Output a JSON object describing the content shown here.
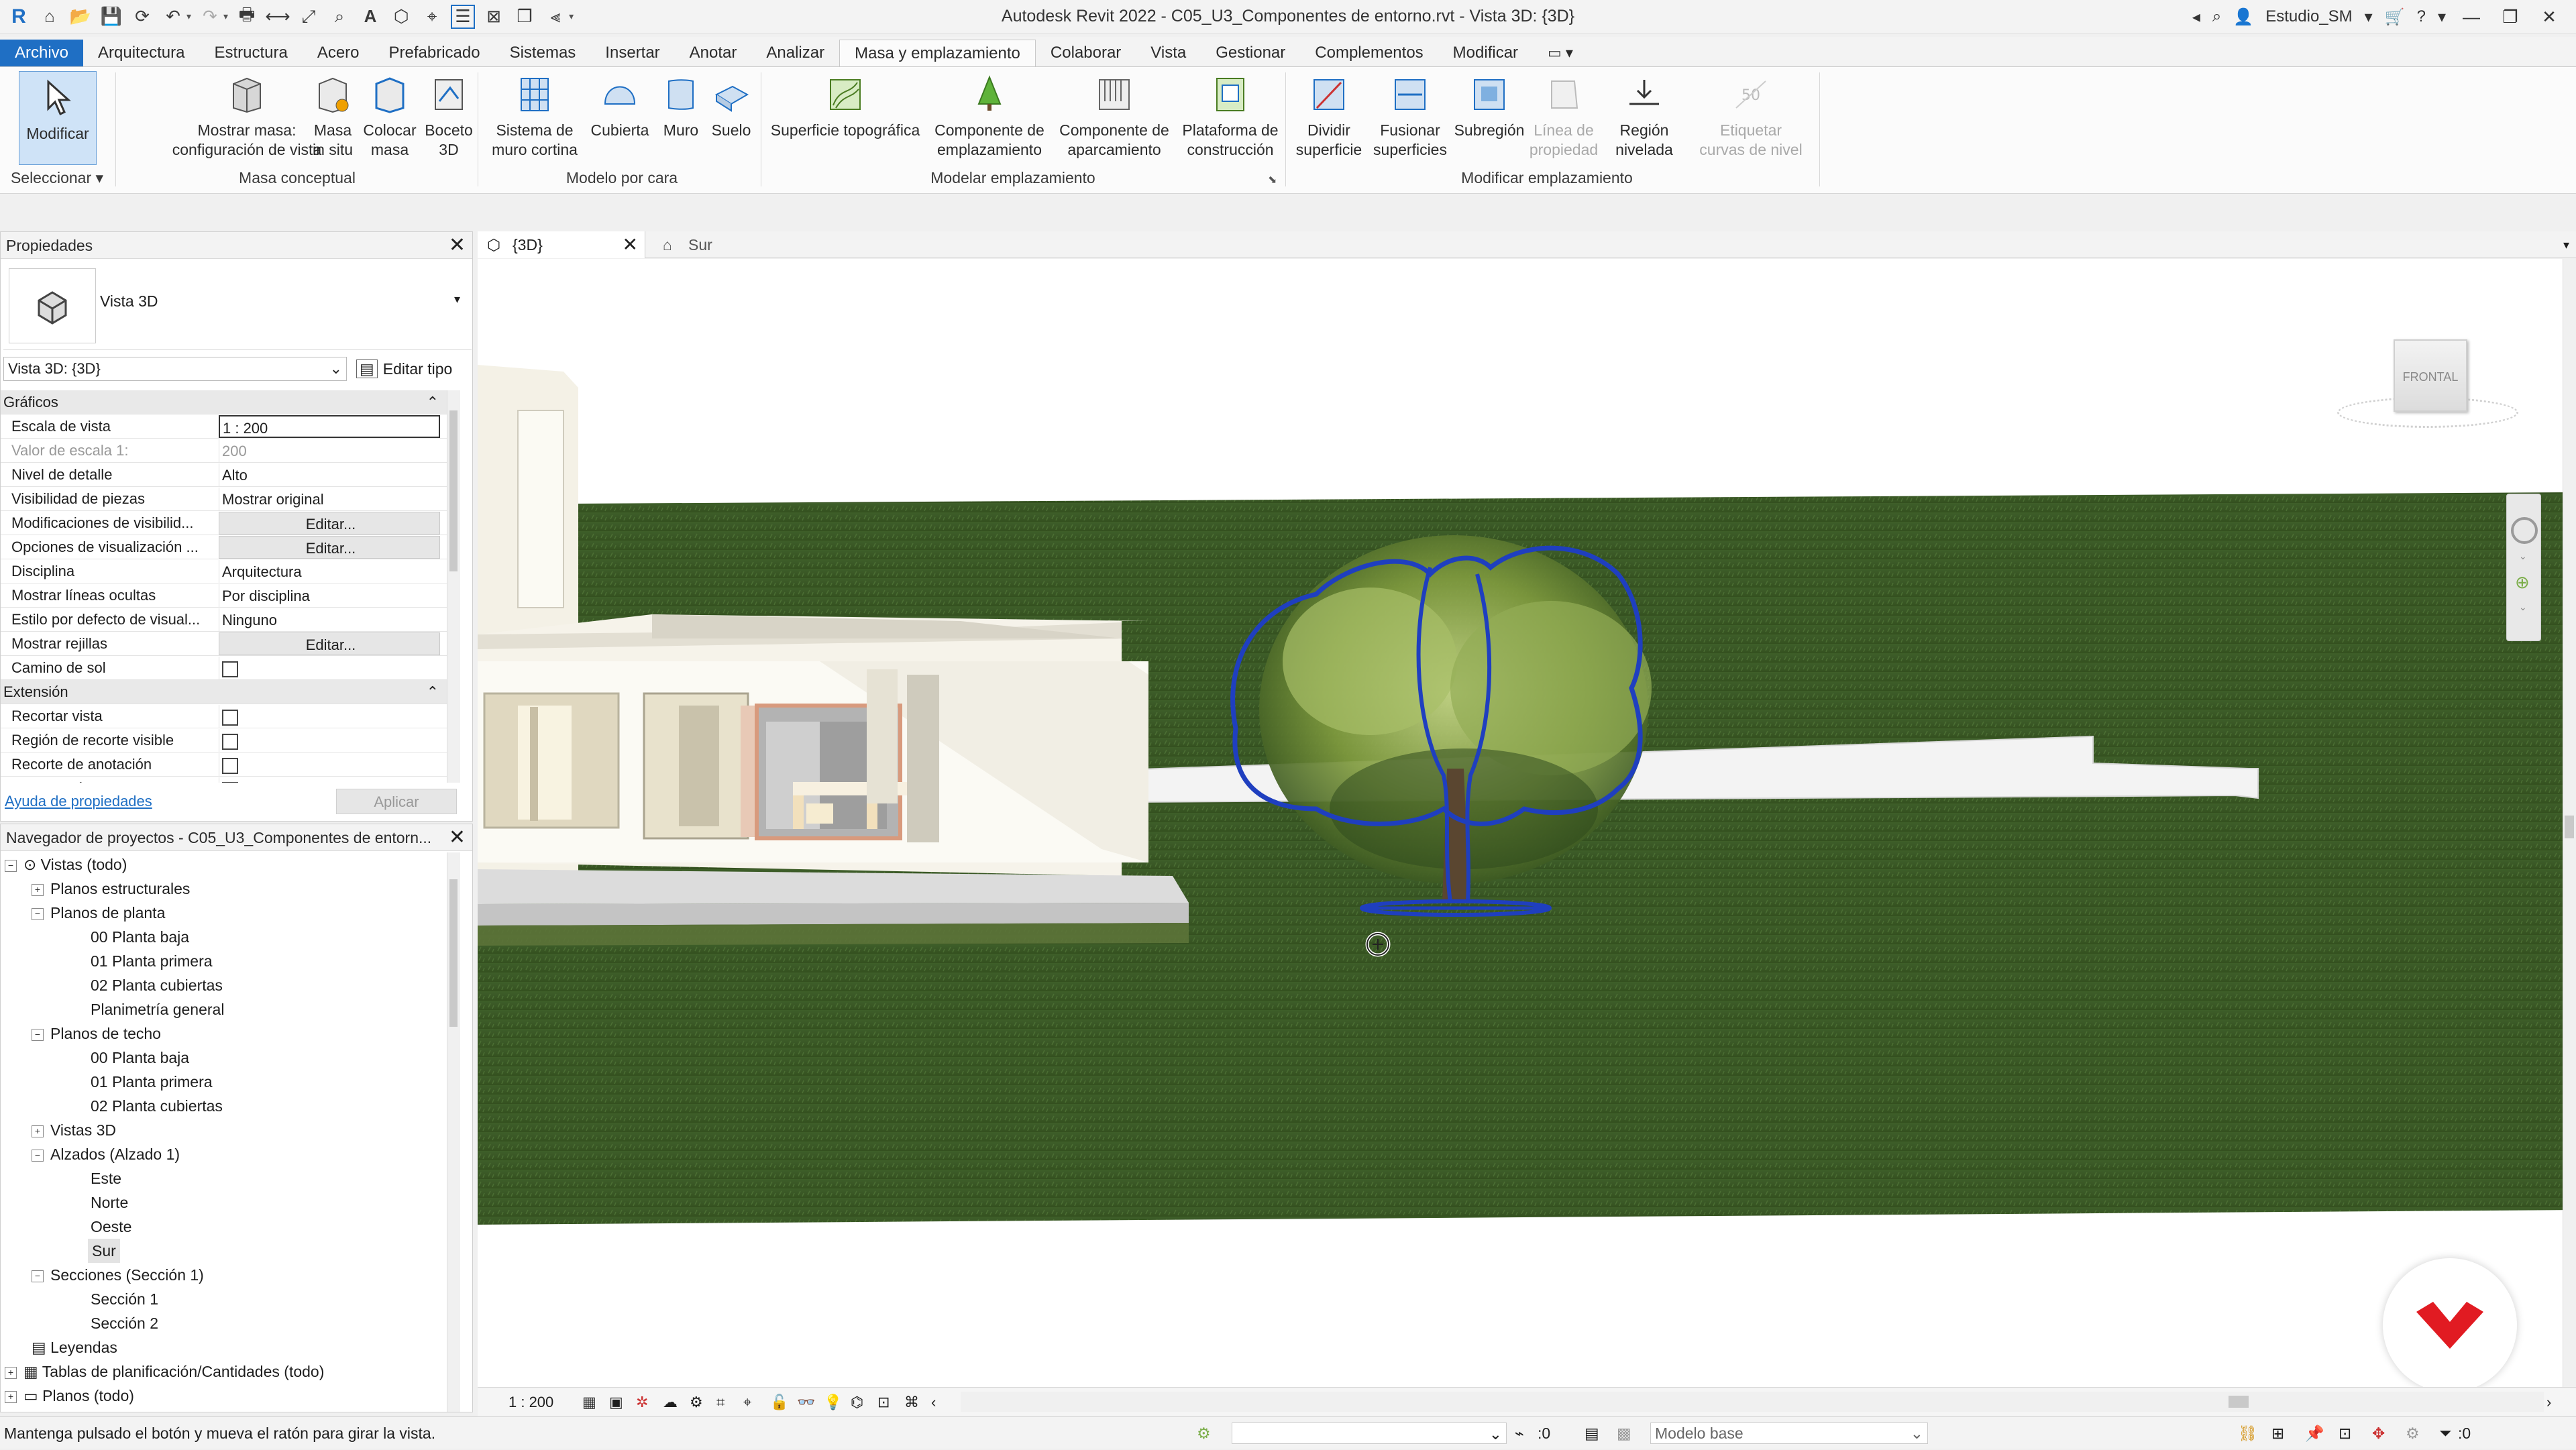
{
  "window": {
    "title": "Autodesk Revit 2022 - C05_U3_Componentes de entorno.rvt - Vista 3D: {3D}",
    "user": "Estudio_SM"
  },
  "tabs": [
    "Archivo",
    "Arquitectura",
    "Estructura",
    "Acero",
    "Prefabricado",
    "Sistemas",
    "Insertar",
    "Anotar",
    "Analizar",
    "Masa y emplazamiento",
    "Colaborar",
    "Vista",
    "Gestionar",
    "Complementos",
    "Modificar"
  ],
  "ribbon": {
    "modify": {
      "label": "Modificar",
      "panel": "Seleccionar ▾"
    },
    "massing": {
      "panel": "Masa conceptual",
      "show_mass_1": "Mostrar masa:",
      "show_mass_2": "configuración de vista",
      "inplace_1": "Masa",
      "inplace_2": "in situ",
      "place_1": "Colocar",
      "place_2": "masa",
      "sketch_1": "Boceto",
      "sketch_2": "3D"
    },
    "byface": {
      "panel": "Modelo por cara",
      "curtain_1": "Sistema de",
      "curtain_2": "muro cortina",
      "roof": "Cubierta",
      "wall": "Muro",
      "floor": "Suelo"
    },
    "site": {
      "panel": "Modelar emplazamiento",
      "toposurface": "Superficie topográfica",
      "component_1": "Componente de",
      "component_2": "emplazamiento",
      "parking_1": "Componente de",
      "parking_2": "aparcamiento",
      "pad_1": "Plataforma de",
      "pad_2": "construcción"
    },
    "modsite": {
      "panel": "Modificar emplazamiento",
      "split_1": "Dividir",
      "split_2": "superficie",
      "merge_1": "Fusionar",
      "merge_2": "superficies",
      "subregion": "Subregión",
      "propline_1": "Línea de",
      "propline_2": "propiedad",
      "graded_1": "Región",
      "graded_2": "nivelada",
      "contour_1": "Etiquetar",
      "contour_2": "curvas de nivel"
    }
  },
  "properties": {
    "title": "Propiedades",
    "type_name": "Vista 3D",
    "selector": "Vista 3D: {3D}",
    "edit_type": "Editar tipo",
    "help": "Ayuda de propiedades",
    "apply": "Aplicar",
    "sections": {
      "graphics": "Gráficos",
      "extents": "Extensión"
    },
    "rows": [
      {
        "k": "Escala de vista",
        "v": "1 : 200"
      },
      {
        "k": "Valor de escala    1:",
        "v": "200"
      },
      {
        "k": "Nivel de detalle",
        "v": "Alto"
      },
      {
        "k": "Visibilidad de piezas",
        "v": "Mostrar original"
      },
      {
        "k": "Modificaciones de visibilid...",
        "v": "Editar..."
      },
      {
        "k": "Opciones de visualización ...",
        "v": "Editar..."
      },
      {
        "k": "Disciplina",
        "v": "Arquitectura"
      },
      {
        "k": "Mostrar líneas ocultas",
        "v": "Por disciplina"
      },
      {
        "k": "Estilo por defecto de visual...",
        "v": "Ninguno"
      },
      {
        "k": "Mostrar rejillas",
        "v": "Editar..."
      },
      {
        "k": "Camino de sol",
        "v": ""
      },
      {
        "k": "Recortar vista",
        "v": ""
      },
      {
        "k": "Región de recorte visible",
        "v": ""
      },
      {
        "k": "Recorte de anotación",
        "v": ""
      },
      {
        "k": "Delimitación lejana activa",
        "v": ""
      }
    ]
  },
  "browser": {
    "title": "Navegador de proyectos - C05_U3_Componentes de entorn...",
    "nodes": [
      "Vistas (todo)",
      "Planos estructurales",
      "Planos de planta",
      "00 Planta baja",
      "01 Planta primera",
      "02 Planta cubiertas",
      "Planimetría general",
      "Planos de techo",
      "00 Planta baja",
      "01 Planta primera",
      "02 Planta cubiertas",
      "Vistas 3D",
      "Alzados (Alzado 1)",
      "Este",
      "Norte",
      "Oeste",
      "Sur",
      "Secciones (Sección 1)",
      "Sección 1",
      "Sección 2",
      "Leyendas",
      "Tablas de planificación/Cantidades (todo)",
      "Planos (todo)"
    ]
  },
  "viewport": {
    "tabs": [
      "{3D}",
      "Sur"
    ],
    "viewcube": "FRONTAL",
    "scale": "1 : 200"
  },
  "statusbar": {
    "hint": "Mantenga pulsado el botón y mueva el ratón para girar la vista.",
    "count": ":0",
    "model": "Modelo base",
    "filter": ":0"
  },
  "colors": {
    "accent": "#1f6fc4",
    "grass": "#3c5a26",
    "outline": "#1f3fbf"
  }
}
